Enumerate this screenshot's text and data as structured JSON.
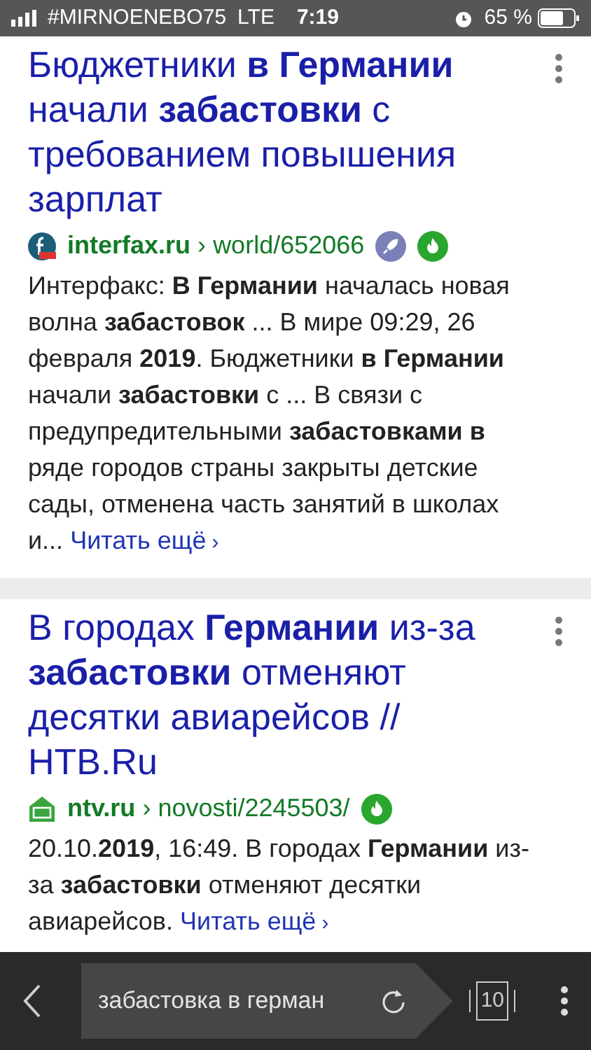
{
  "status_bar": {
    "carrier": "#MIRNOENEBO75",
    "network": "LTE",
    "time": "7:19",
    "battery": "65 %"
  },
  "results": [
    {
      "title": "Бюджетники **в Германии** начали **забастовки** с требованием повышения зарплат",
      "site": "interfax.ru",
      "separator": "›",
      "path": "world/652066",
      "logo": {
        "kind": "interfax"
      },
      "badges": [
        {
          "kind": "rocket"
        },
        {
          "kind": "fire"
        }
      ],
      "snippet": "Интерфакс: **В Германии** началась новая волна **забастовок** ... В мире 09:29, 26 февраля **2019**. Бюджетники **в Германии** начали **забастовки** с ... В связи с предупредительными **забастовками в** ряде городов страны закрыты детские сады, отменена часть занятий в школах и...",
      "more": "Читать ещё",
      "more_chevron": "›"
    },
    {
      "title": "В городах **Германии** из-за **забастовки** отменяют десятки авиарейсов // НТВ.Ru",
      "site": "ntv.ru",
      "separator": "›",
      "path": "novosti/2245503/",
      "logo": {
        "kind": "ntv"
      },
      "badges": [
        {
          "kind": "fire"
        }
      ],
      "snippet": "20.10.**2019**, 16:49. В городах **Германии** из-за **забастовки** отменяют десятки авиарейсов.",
      "more": "Читать ещё",
      "more_chevron": "›"
    }
  ],
  "toolbar": {
    "query": "забастовка в герман",
    "tabs_count": "10"
  }
}
